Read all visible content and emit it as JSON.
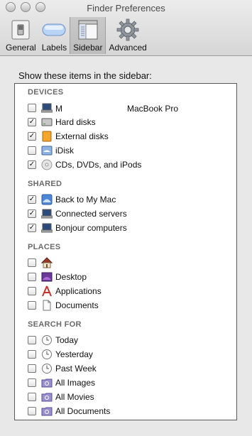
{
  "window": {
    "title": "Finder Preferences"
  },
  "toolbar": {
    "items": [
      {
        "label": "General",
        "icon": "switch-icon"
      },
      {
        "label": "Labels",
        "icon": "label-pill-icon"
      },
      {
        "label": "Sidebar",
        "icon": "sidebar-window-icon",
        "selected": true
      },
      {
        "label": "Advanced",
        "icon": "gear-icon"
      }
    ]
  },
  "prompt": "Show these items in the sidebar:",
  "sections": {
    "devices": {
      "title": "DEVICES",
      "items": [
        {
          "label_prefix": "M",
          "label": "MacBook Pro",
          "checked": false,
          "icon": "laptop-icon"
        },
        {
          "label": "Hard disks",
          "checked": true,
          "icon": "hard-disk-icon"
        },
        {
          "label": "External disks",
          "checked": true,
          "icon": "external-disk-icon"
        },
        {
          "label": "iDisk",
          "checked": false,
          "icon": "idisk-icon"
        },
        {
          "label": "CDs, DVDs, and iPods",
          "checked": true,
          "icon": "cd-icon"
        }
      ]
    },
    "shared": {
      "title": "SHARED",
      "items": [
        {
          "label": "Back to My Mac",
          "checked": true,
          "icon": "back-to-my-mac-icon"
        },
        {
          "label": "Connected servers",
          "checked": true,
          "icon": "server-icon"
        },
        {
          "label": "Bonjour computers",
          "checked": true,
          "icon": "bonjour-computer-icon"
        }
      ]
    },
    "places": {
      "title": "PLACES",
      "items": [
        {
          "label": "",
          "checked": false,
          "icon": "home-icon"
        },
        {
          "label": "Desktop",
          "checked": false,
          "icon": "desktop-icon"
        },
        {
          "label": "Applications",
          "checked": false,
          "icon": "applications-icon"
        },
        {
          "label": "Documents",
          "checked": false,
          "icon": "document-icon"
        }
      ]
    },
    "search_for": {
      "title": "SEARCH FOR",
      "items": [
        {
          "label": "Today",
          "checked": false,
          "icon": "clock-icon"
        },
        {
          "label": "Yesterday",
          "checked": false,
          "icon": "clock-icon"
        },
        {
          "label": "Past Week",
          "checked": false,
          "icon": "clock-icon"
        },
        {
          "label": "All Images",
          "checked": false,
          "icon": "smart-folder-icon"
        },
        {
          "label": "All Movies",
          "checked": false,
          "icon": "smart-folder-icon"
        },
        {
          "label": "All Documents",
          "checked": false,
          "icon": "smart-folder-icon"
        }
      ]
    }
  },
  "check_glyph": "✓"
}
